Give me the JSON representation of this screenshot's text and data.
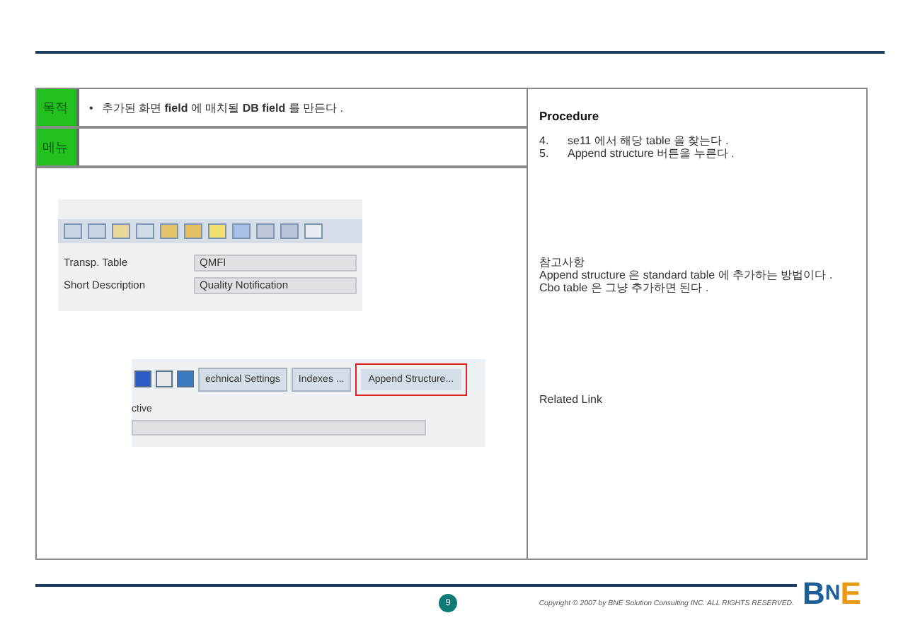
{
  "header_rows": [
    {
      "label": "목적",
      "bullet": "•",
      "content": "추가된 화면 **field** 에 매치될 **DB field** 를 만든다 ."
    },
    {
      "label": "메뉴",
      "content": ""
    }
  ],
  "screenshot_table": {
    "fields": [
      {
        "label": "Transp. Table",
        "value": "QMFI"
      },
      {
        "label": "Short Description",
        "value": "Quality Notification"
      }
    ]
  },
  "screenshot_buttons": {
    "tabs": [
      {
        "label": "echnical Settings",
        "highlighted": false
      },
      {
        "label": "Indexes ...",
        "highlighted": false
      },
      {
        "label": "Append Structure...",
        "highlighted": true
      }
    ],
    "field_label": "ctive"
  },
  "procedure": {
    "title": "Procedure",
    "steps": [
      {
        "number": "4.",
        "text": "se11 에서 해당 table 을 찾는다 ."
      },
      {
        "number": "5.",
        "text": "Append structure 버튼을 누른다 ."
      }
    ]
  },
  "notes": {
    "title": "참고사항",
    "lines": [
      "Append structure 은 standard table 에 추가하는 방법이다 .",
      "Cbo table 은 그냥 추가하면 된다 ."
    ]
  },
  "related_link": "Related Link",
  "footer": {
    "page": "9",
    "copyright": "Copyright © 2007 by BNE Solution Consulting INC.   ALL RIGHTS RESERVED.",
    "logo": [
      "B",
      "N",
      "E"
    ]
  }
}
